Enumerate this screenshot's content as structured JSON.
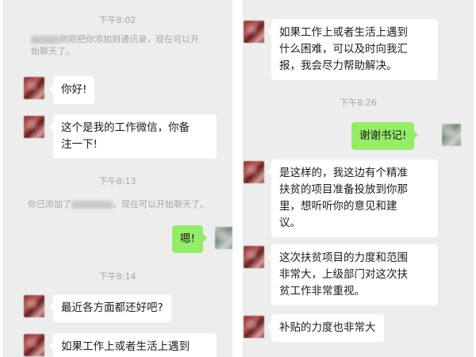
{
  "left": {
    "time_1": "下午8:02",
    "sys_1_line1": "刚刚把你添加到通讯录，现在可以开",
    "sys_1_line2": "始聊天了。",
    "msg_1": "你好!",
    "msg_2_line1": "这个是我的工作微信，你备",
    "msg_2_line2": "注一下!",
    "time_2": "下午8:13",
    "sys_2_prefix": "你已添加了",
    "sys_2_suffix": "，现在可以开始聊天了。",
    "msg_3": "嗯!",
    "time_3": "下午8:14",
    "msg_4": "最近各方面都还好吧?",
    "msg_5_line1": "如果工作上或者生活上遇到"
  },
  "right": {
    "msg_1_line1": "如果工作上或者生活上遇到",
    "msg_1_line2": "什么困难，可以及时向我汇",
    "msg_1_line3": "报，我会尽力帮助解决。",
    "time_1": "下午8:26",
    "msg_2": "谢谢书记!",
    "msg_3_line1": "是这样的，我这边有个精准",
    "msg_3_line2": "扶贫的项目准备投放到你那",
    "msg_3_line3": "里，想听听你的意见和建",
    "msg_3_line4": "议。",
    "msg_4_line1": "这次扶贫项目的力度和范围",
    "msg_4_line2": "非常大，上级部门对这次扶",
    "msg_4_line3": "贫工作非常重视。",
    "msg_5": "补贴的力度也非常大"
  }
}
